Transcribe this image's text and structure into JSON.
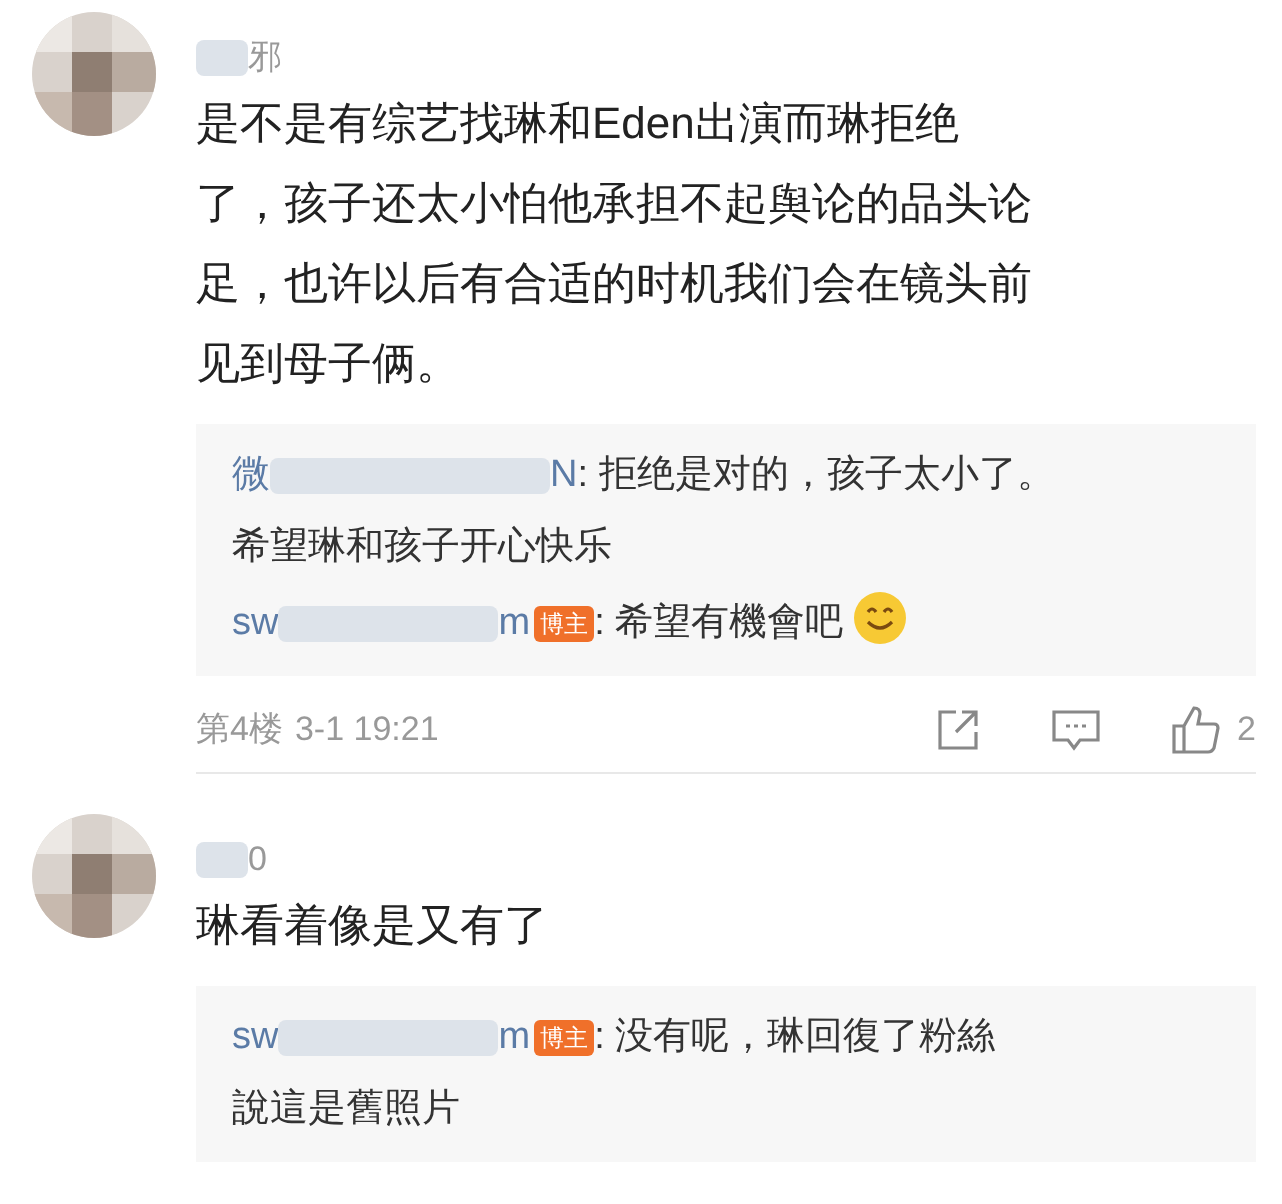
{
  "comments": [
    {
      "name_end": "邪",
      "lines": [
        "是不是有综艺找琳和Eden出演而琳拒绝",
        "了，孩子还太小怕他承担不起舆论的品头论",
        "足，也许以后有合适的时机我们会在镜头前",
        "见到母子俩。"
      ],
      "replies": [
        {
          "name_start": "微",
          "name_end": "N",
          "lines": [
            ": 拒绝是对的，孩子太小了。",
            "希望琳和孩子开心快乐"
          ],
          "emoji": false
        },
        {
          "name_start": "sw",
          "name_end": "m",
          "author_badge": "博主",
          "lines": [
            ": 希望有機會吧"
          ],
          "emoji": true
        }
      ],
      "footer": {
        "floor": "第4楼",
        "time": "3-1 19:21",
        "likes": "2"
      }
    },
    {
      "name_end": "0",
      "lines": [
        "琳看着像是又有了"
      ],
      "replies": [
        {
          "name_start": "sw",
          "name_end": "m",
          "author_badge": "博主",
          "lines": [
            ": 没有呢，琳回復了粉絲",
            "說這是舊照片"
          ],
          "emoji": false
        }
      ]
    }
  ]
}
